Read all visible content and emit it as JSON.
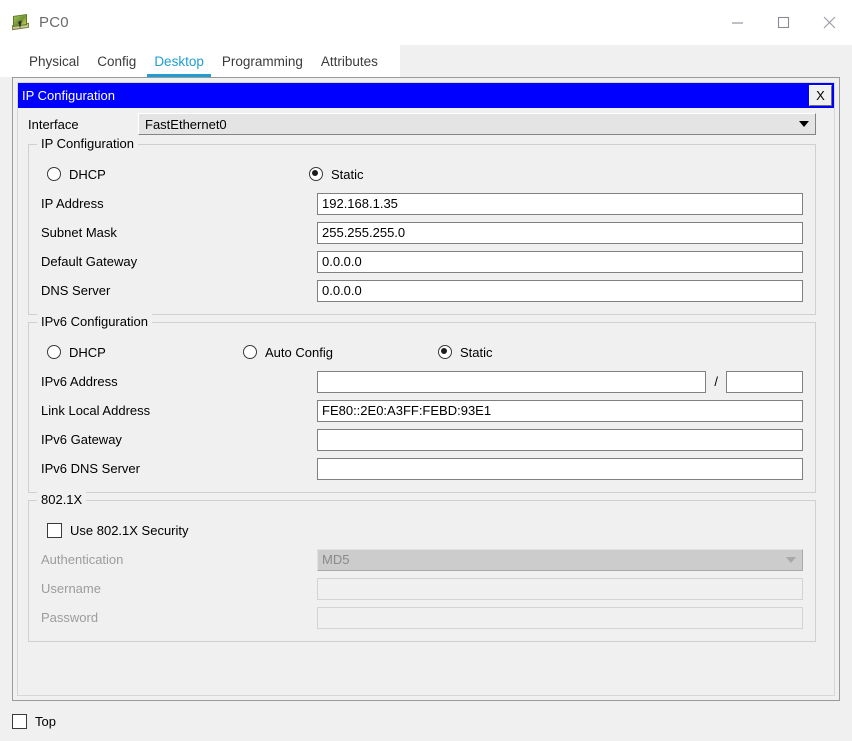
{
  "window": {
    "title": "PC0",
    "icon": "pc-device-icon",
    "controls": {
      "minimize": "minimize-icon",
      "maximize": "maximize-icon",
      "close": "close-icon"
    }
  },
  "tabs": [
    {
      "label": "Physical",
      "active": false
    },
    {
      "label": "Config",
      "active": false
    },
    {
      "label": "Desktop",
      "active": true
    },
    {
      "label": "Programming",
      "active": false
    },
    {
      "label": "Attributes",
      "active": false
    }
  ],
  "panel": {
    "caption_title": "IP Configuration",
    "close_label": "X",
    "caption_bg": "#0000ff"
  },
  "interface": {
    "label": "Interface",
    "value": "FastEthernet0"
  },
  "ipv4": {
    "legend": "IP Configuration",
    "mode_options": [
      "DHCP",
      "Static"
    ],
    "dhcp_label": "DHCP",
    "static_label": "Static",
    "selected_mode": "Static",
    "fields": [
      {
        "label": "IP Address",
        "value": "192.168.1.35"
      },
      {
        "label": "Subnet Mask",
        "value": "255.255.255.0"
      },
      {
        "label": "Default Gateway",
        "value": "0.0.0.0"
      },
      {
        "label": "DNS Server",
        "value": "0.0.0.0"
      }
    ]
  },
  "ipv6": {
    "legend": "IPv6 Configuration",
    "dhcp_label": "DHCP",
    "auto_config_label": "Auto Config",
    "static_label": "Static",
    "selected_mode": "Static",
    "address_label": "IPv6 Address",
    "address_value": "",
    "prefix_separator": "/",
    "prefix_value": "",
    "fields": [
      {
        "label": "Link Local Address",
        "value": "FE80::2E0:A3FF:FEBD:93E1"
      },
      {
        "label": "IPv6 Gateway",
        "value": ""
      },
      {
        "label": "IPv6 DNS Server",
        "value": ""
      }
    ]
  },
  "dot1x": {
    "legend": "802.1X",
    "use_security_label": "Use 802.1X Security",
    "use_security_checked": false,
    "authentication_label": "Authentication",
    "authentication_value": "MD5",
    "username_label": "Username",
    "username_value": "",
    "password_label": "Password",
    "password_value": "",
    "disabled": true
  },
  "bottom": {
    "top_label": "Top",
    "top_checked": false
  },
  "colors": {
    "accent_tab": "#1f9dd4",
    "caption": "#0000ff",
    "window_bg": "#f0f0f0"
  }
}
